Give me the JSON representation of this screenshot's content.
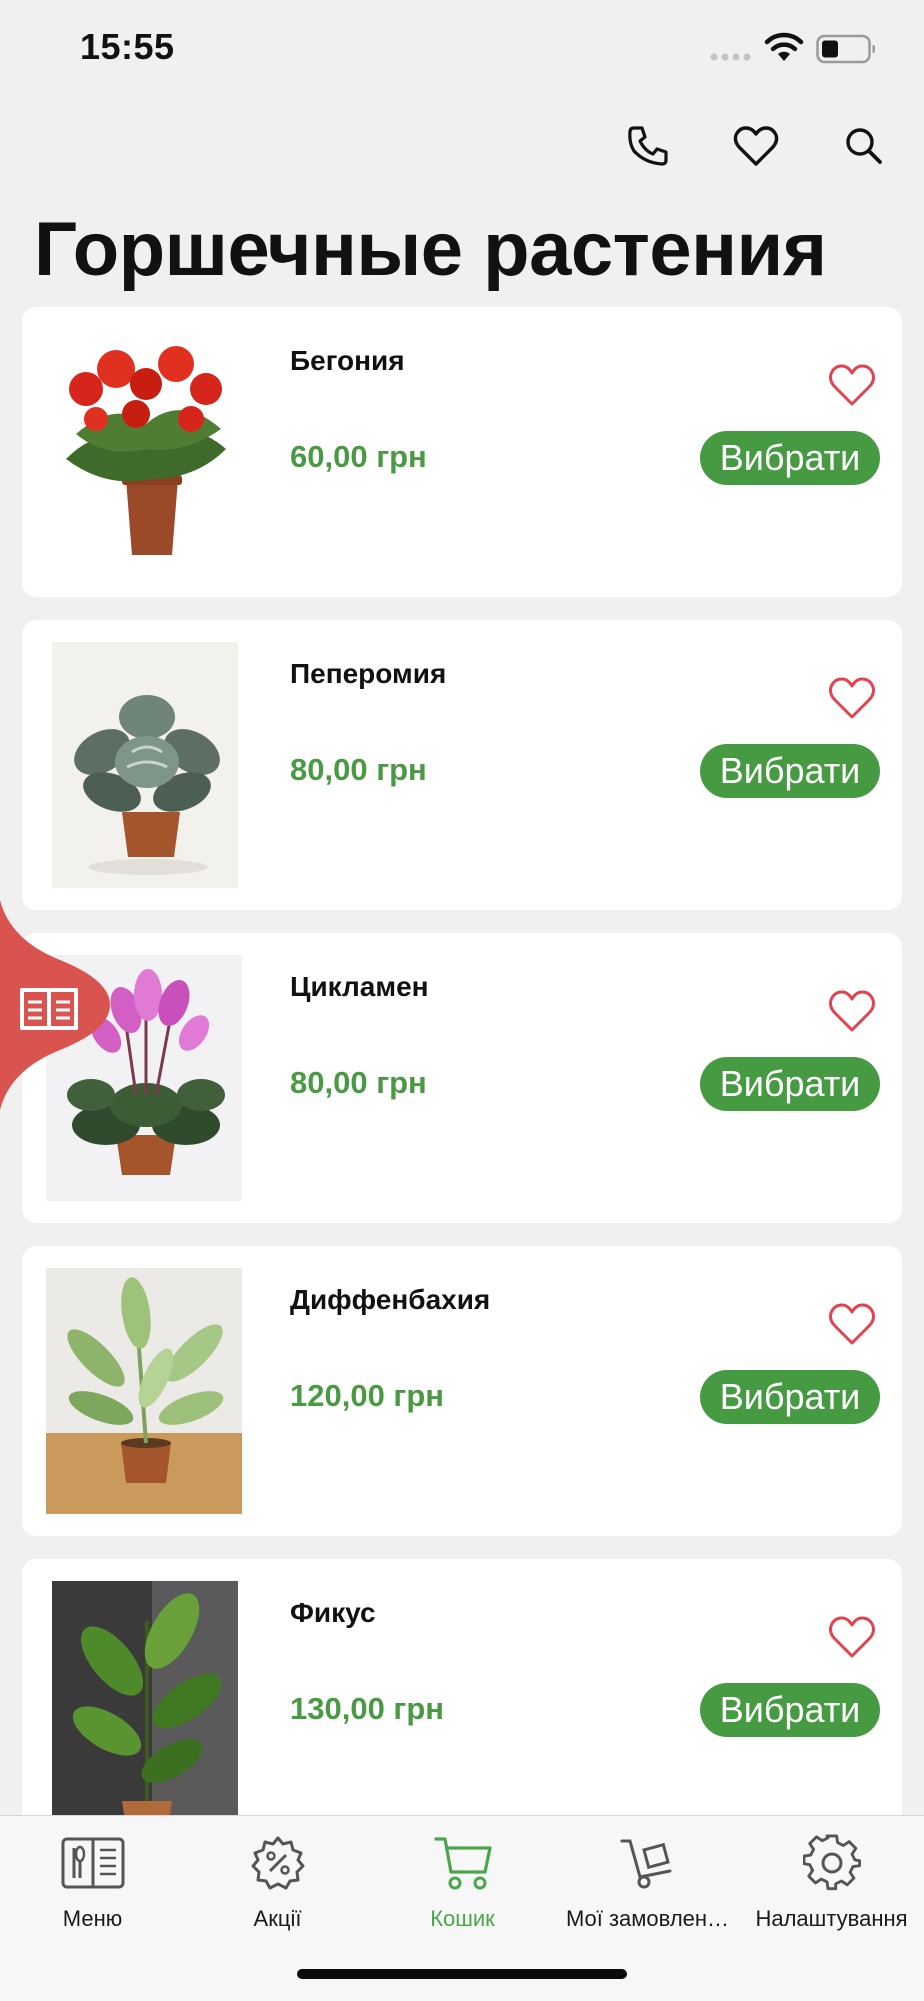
{
  "status_bar": {
    "time": "15:55"
  },
  "header": {
    "title": "Горшечные растения",
    "icons": [
      "phone-icon",
      "heart-icon",
      "search-icon"
    ]
  },
  "colors": {
    "accent_green": "#469a42",
    "price_green": "#4a9a44",
    "heart_red": "#e2434f",
    "side_tab_red": "#d9534f",
    "background": "#f0f0f0"
  },
  "products": [
    {
      "name": "Бегония",
      "price": "60,00 грн",
      "button": "Вибрати"
    },
    {
      "name": "Пеперомия",
      "price": "80,00 грн",
      "button": "Вибрати"
    },
    {
      "name": "Цикламен",
      "price": "80,00 грн",
      "button": "Вибрати"
    },
    {
      "name": "Диффенбахия",
      "price": "120,00 грн",
      "button": "Вибрати"
    },
    {
      "name": "Фикус",
      "price": "130,00 грн",
      "button": "Вибрати"
    }
  ],
  "side_tab": {
    "icon": "book-icon"
  },
  "bottom_nav": {
    "active": "Кошик",
    "items": [
      {
        "label": "Меню",
        "icon": "menu-book-icon"
      },
      {
        "label": "Акції",
        "icon": "discount-gear-icon"
      },
      {
        "label": "Кошик",
        "icon": "cart-icon"
      },
      {
        "label": "Мої замовлен…",
        "icon": "hand-truck-icon"
      },
      {
        "label": "Налаштування",
        "icon": "settings-gear-icon"
      }
    ]
  }
}
